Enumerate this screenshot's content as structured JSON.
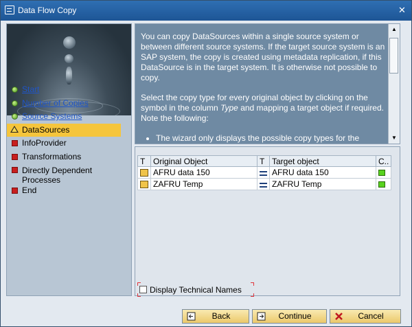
{
  "window": {
    "title": "Data Flow Copy"
  },
  "steps": [
    {
      "label": "Start",
      "status": "ok",
      "link": true
    },
    {
      "label": "Number of Copies",
      "status": "ok",
      "link": true
    },
    {
      "label": "Source Systems",
      "status": "ok",
      "link": true
    },
    {
      "label": "DataSources",
      "status": "warning",
      "active": true
    },
    {
      "label": "InfoProvider",
      "status": "error"
    },
    {
      "label": "Transformations",
      "status": "error"
    },
    {
      "label": "Directly Dependent Processes",
      "status": "error"
    },
    {
      "label": "End",
      "status": "error"
    }
  ],
  "info": {
    "para1": "You can copy DataSources within a single source system or between different source systems. If the target source system is an SAP system, the copy is created using metadata replication, if this DataSource is in the target system. It is otherwise not possible to copy.",
    "para2_pre": "Select the copy type for every original object by clicking on the symbol in the column ",
    "para2_em": "Type",
    "para2_post": " and mapping a target object if required. Note the following:",
    "bullet1": "The wizard only displays the possible copy types for the relevant"
  },
  "table": {
    "headers": {
      "t": "T",
      "original": "Original Object",
      "t2": "T",
      "target": "Target object",
      "c": "C.."
    },
    "rows": [
      {
        "original": "AFRU data 150",
        "target": "AFRU data 150"
      },
      {
        "original": "ZAFRU Temp",
        "target": "ZAFRU Temp"
      }
    ]
  },
  "options": {
    "display_technical_names": "Display Technical Names"
  },
  "buttons": {
    "back": "Back",
    "continue": "Continue",
    "cancel": "Cancel"
  },
  "colors": {
    "title_bar": "#2466aa",
    "active_step": "#f5c53c",
    "info_bg": "#6f8aa3",
    "button": "#f1d98c"
  }
}
